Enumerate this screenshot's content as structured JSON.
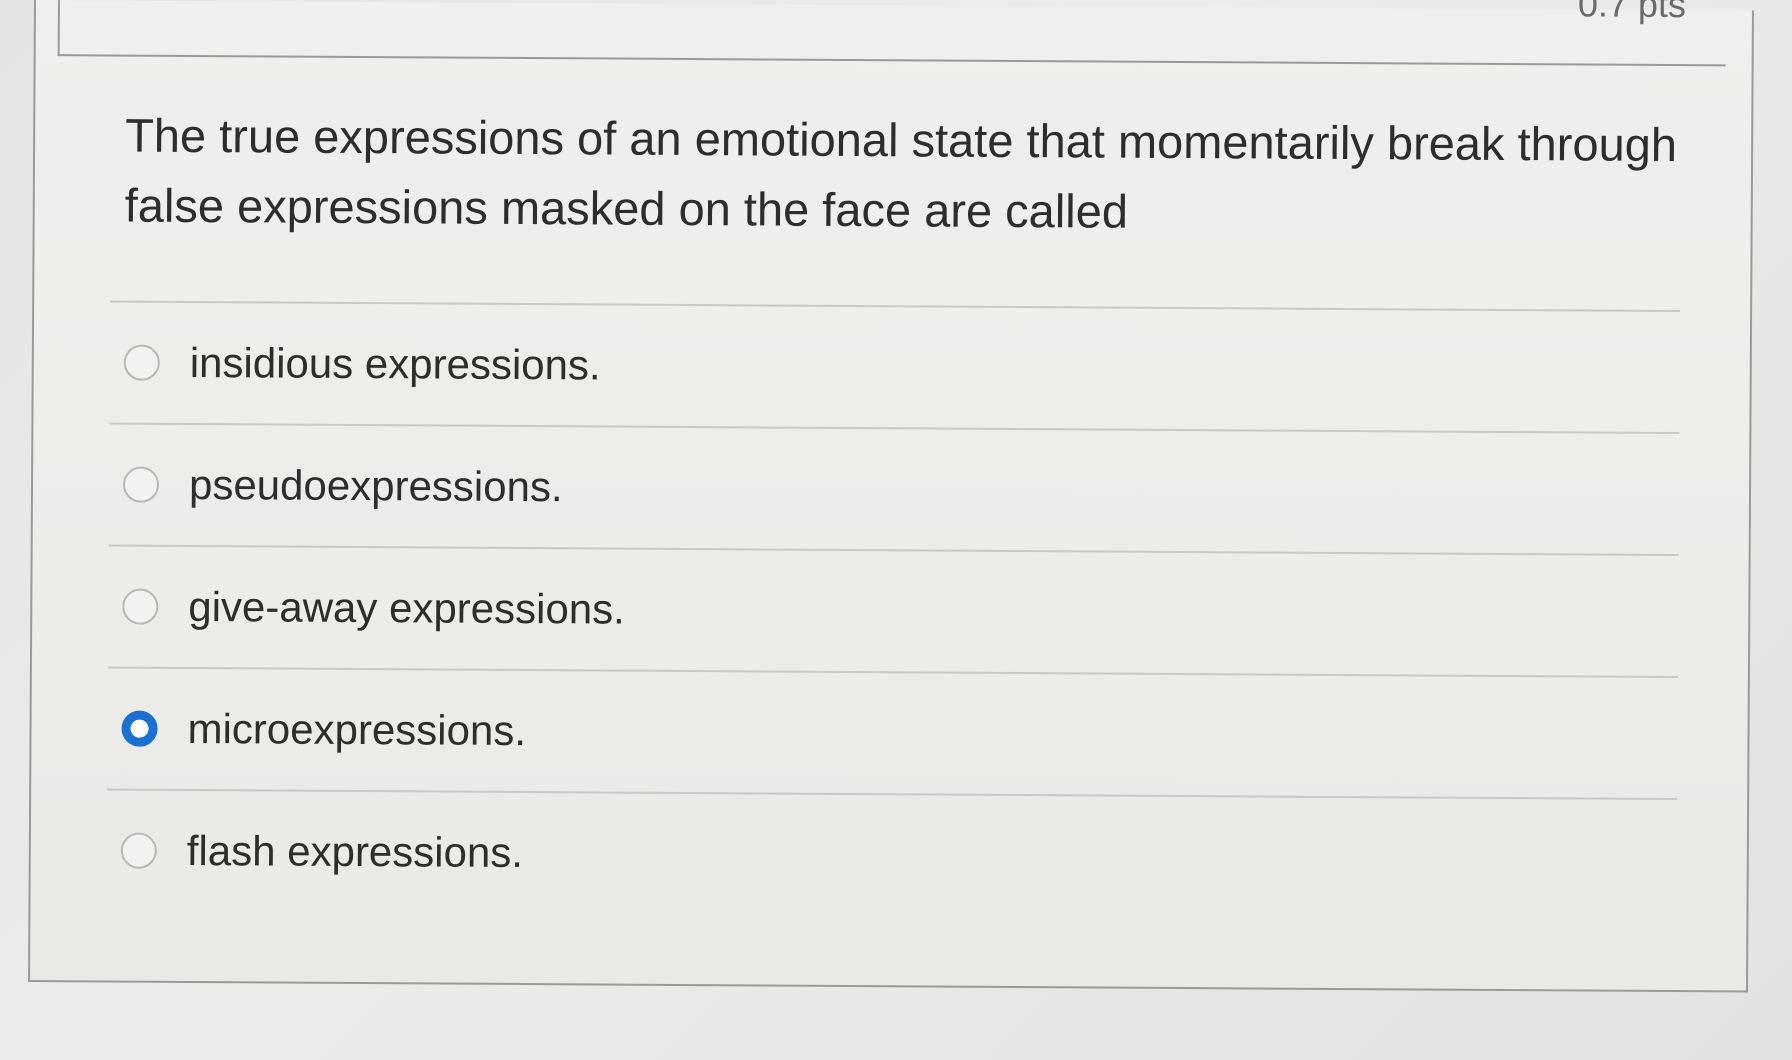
{
  "question": {
    "points": "0.7 pts",
    "text": "The true expressions of an emotional state that momentarily break through false expressions masked on the face are called"
  },
  "answers": [
    {
      "label": "insidious expressions.",
      "selected": false
    },
    {
      "label": "pseudoexpressions.",
      "selected": false
    },
    {
      "label": "give-away expressions.",
      "selected": false
    },
    {
      "label": "microexpressions.",
      "selected": true
    },
    {
      "label": "flash expressions.",
      "selected": false
    }
  ],
  "colors": {
    "selected_radio": "#1a6fd0",
    "text": "#2d2d2b",
    "border": "#9a9a98"
  }
}
